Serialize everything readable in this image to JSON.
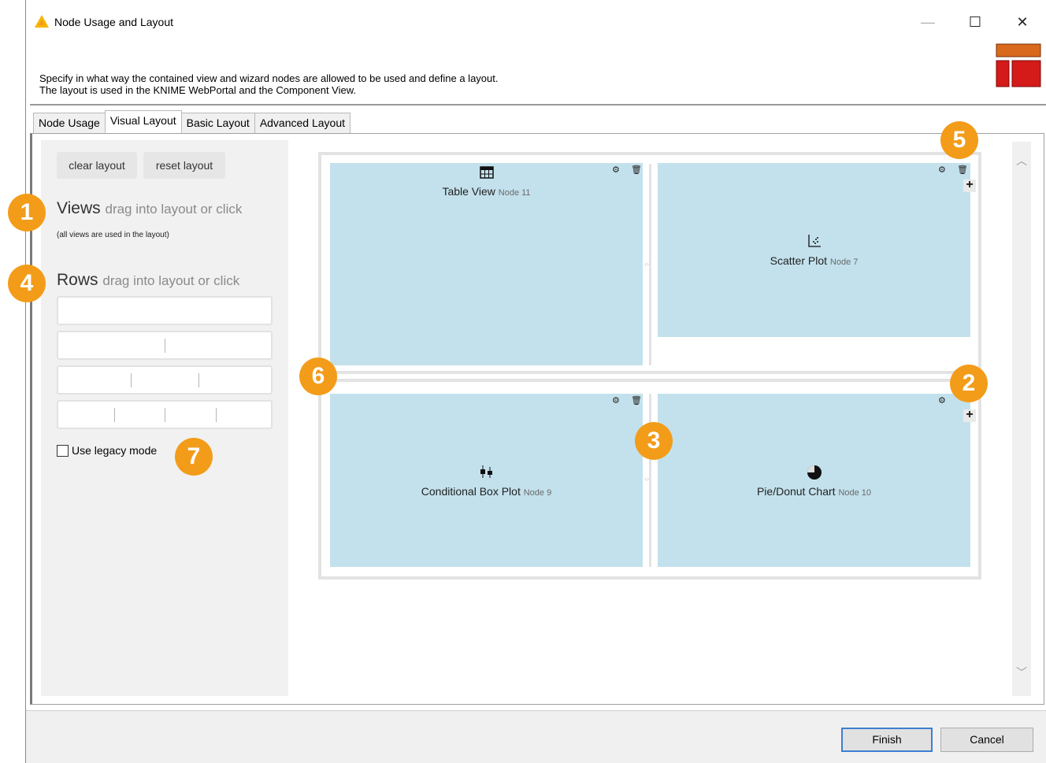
{
  "window": {
    "title": "Node Usage and Layout",
    "controls": {
      "minimize": "—",
      "maximize": "☐",
      "close": "✕"
    }
  },
  "description": {
    "line1": "Specify in what way the contained view and wizard nodes are allowed to be used and define a layout.",
    "line2": "The layout is used in the KNIME WebPortal and the Component View."
  },
  "tabs": [
    {
      "label": "Node Usage",
      "active": false
    },
    {
      "label": "Visual Layout",
      "active": true
    },
    {
      "label": "Basic Layout",
      "active": false
    },
    {
      "label": "Advanced Layout",
      "active": false
    }
  ],
  "sidebar": {
    "clear_label": "clear layout",
    "reset_label": "reset layout",
    "views_title": "Views",
    "views_hint": "drag into layout or click",
    "views_note": "(all views are used in the layout)",
    "rows_title": "Rows",
    "rows_hint": "drag into layout or click",
    "row_templates": [
      1,
      2,
      3,
      4
    ],
    "legacy_label": "Use legacy mode",
    "legacy_checked": false
  },
  "layout": {
    "views": [
      {
        "name": "Table View",
        "node": "Node 11",
        "icon": "table-icon"
      },
      {
        "name": "Scatter Plot",
        "node": "Node 7",
        "icon": "scatter-plot-icon"
      },
      {
        "name": "Conditional Box Plot",
        "node": "Node 9",
        "icon": "box-plot-icon"
      },
      {
        "name": "Pie/Donut Chart",
        "node": "Node 10",
        "icon": "pie-chart-icon"
      }
    ]
  },
  "callouts": [
    "1",
    "2",
    "3",
    "4",
    "5",
    "6",
    "7"
  ],
  "footer": {
    "finish_label": "Finish",
    "cancel_label": "Cancel"
  },
  "colors": {
    "accent_orange": "#f39c19",
    "view_fill": "#c3e1ec",
    "logo_orange": "#d9691c",
    "logo_red": "#d51a1a"
  }
}
